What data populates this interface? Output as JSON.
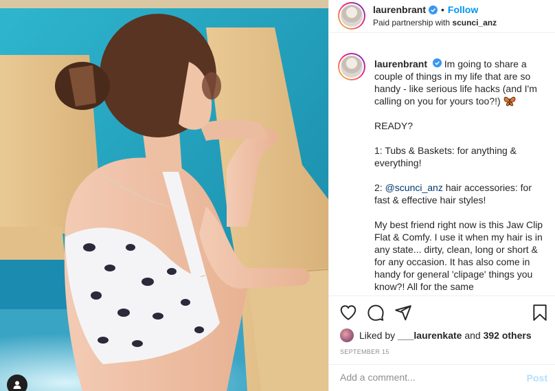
{
  "post": {
    "author": "laurenbrant",
    "follow_label": "Follow",
    "partnership_prefix": "Paid partnership with",
    "partner": "scunci_anz"
  },
  "caption": {
    "username": "laurenbrant",
    "intro": "Im going to share a couple of things in my life that are so handy - like serious life hacks (and I'm calling on you for yours too?!)",
    "ready": "READY?",
    "item1": "1: Tubs & Baskets: for anything & everything!",
    "item2_prefix": "2:",
    "item2_mention": "@scunci_anz",
    "item2_rest": "hair accessories: for fast & effective hair styles!",
    "para": "My best friend right now is this Jaw Clip Flat & Comfy. I use it when my hair is in any state... dirty, clean, long or short & for any occasion. It has also come in handy for general 'clipage' things you know?! All for the same"
  },
  "likes": {
    "prefix": "Liked by",
    "liker": "___laurenkate",
    "and": "and",
    "others": "392 others"
  },
  "date": "SEPTEMBER 15",
  "comment": {
    "placeholder": "Add a comment...",
    "post_label": "Post"
  },
  "icons": {
    "like": "heart-icon",
    "comment": "comment-icon",
    "share": "paper-plane-icon",
    "save": "bookmark-icon",
    "verified": "verified-badge-icon",
    "user_tag": "user-tag-icon"
  },
  "colors": {
    "link_blue": "#0095f6",
    "verified_blue": "#3897f0",
    "mention": "#00376b",
    "muted": "#8e8e8e",
    "post_disabled": "#b2dffc"
  }
}
